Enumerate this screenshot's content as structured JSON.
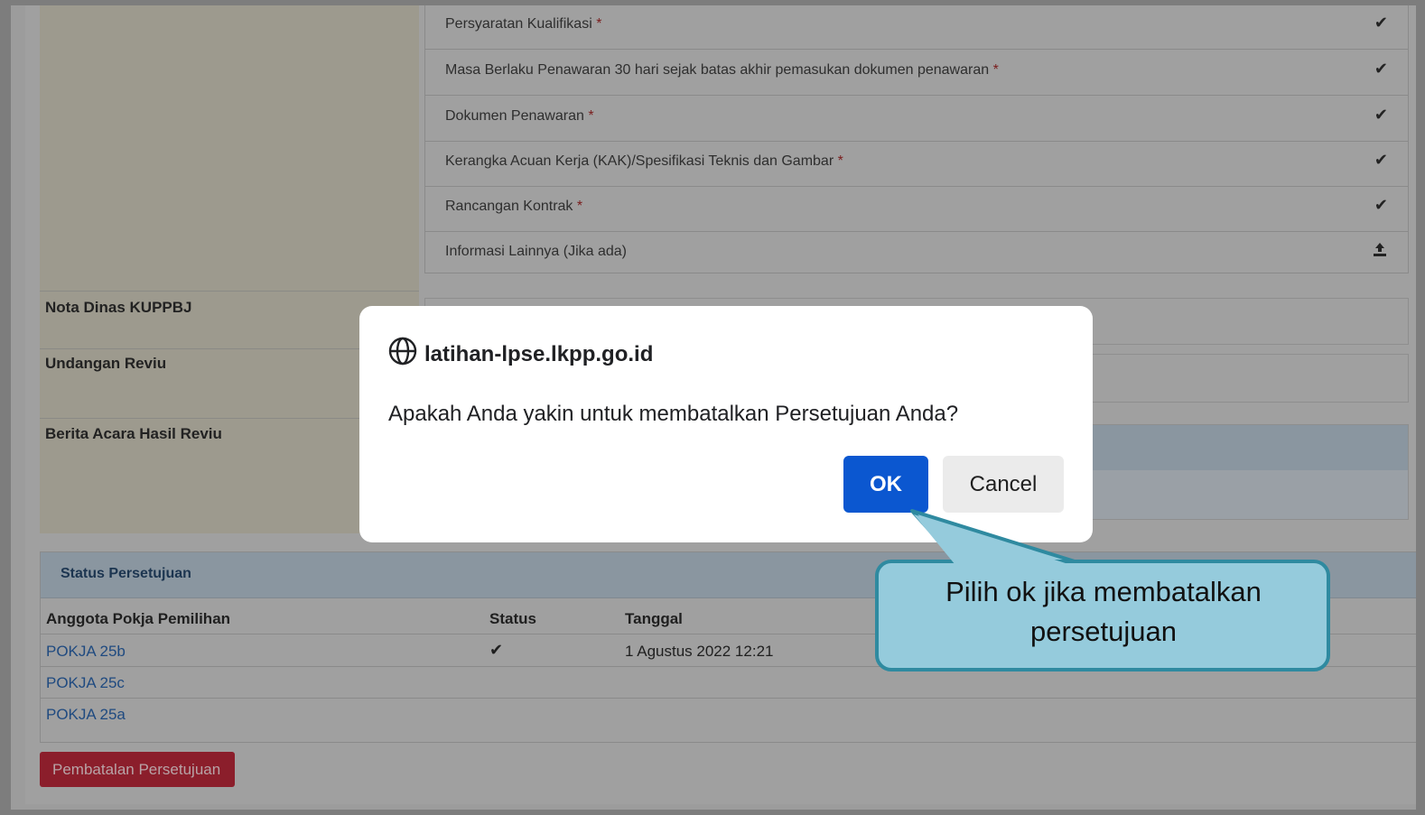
{
  "checklist": [
    {
      "label": "Persyaratan Kualifikasi",
      "required": "*",
      "icon": "check-icon"
    },
    {
      "label": "Masa Berlaku Penawaran 30 hari sejak batas akhir pemasukan dokumen penawaran",
      "required": "*",
      "icon": "check-icon"
    },
    {
      "label": "Dokumen Penawaran",
      "required": "*",
      "icon": "check-icon"
    },
    {
      "label": "Kerangka Acuan Kerja (KAK)/Spesifikasi Teknis dan Gambar",
      "required": "*",
      "icon": "check-icon"
    },
    {
      "label": "Rancangan Kontrak",
      "required": "*",
      "icon": "check-icon"
    },
    {
      "label": "Informasi Lainnya (Jika ada)",
      "required": "",
      "icon": "upload-icon"
    }
  ],
  "left_labels": {
    "nota": "Nota Dinas KUPPBJ",
    "undangan": "Undangan Reviu",
    "berita": "Berita Acara Hasil Reviu"
  },
  "status": {
    "title": "Status Persetujuan",
    "headers": {
      "member": "Anggota Pokja Pemilihan",
      "status": "Status",
      "date": "Tanggal"
    },
    "rows": [
      {
        "member": "POKJA 25b",
        "status": "check-icon",
        "date": "1 Agustus 2022 12:21"
      },
      {
        "member": "POKJA 25c",
        "status": "",
        "date": ""
      },
      {
        "member": "POKJA 25a",
        "status": "",
        "date": ""
      }
    ]
  },
  "cancel_approval_label": "Pembatalan Persetujuan",
  "dialog": {
    "origin": "latihan-lpse.lkpp.go.id",
    "message": "Apakah Anda yakin untuk membatalkan Persetujuan Anda?",
    "ok_label": "OK",
    "cancel_label": "Cancel"
  },
  "callout": {
    "line1": "Pilih ok jika membatalkan",
    "line2": "persetujuan"
  },
  "colors": {
    "ok_button": "#0b57d0",
    "danger_button": "#8b1e2b",
    "callout_fill": "#95cbdc",
    "callout_border": "#2f8aa0"
  }
}
